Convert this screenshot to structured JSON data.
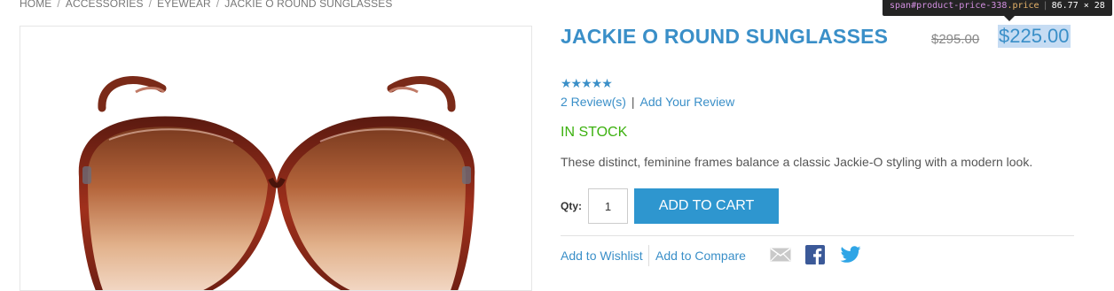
{
  "breadcrumb": {
    "items": [
      "HOME",
      "ACCESSORIES",
      "EYEWEAR",
      "JACKIE O ROUND SUNGLASSES"
    ],
    "separator": "/"
  },
  "product": {
    "title": "JACKIE O ROUND SUNGLASSES",
    "old_price": "$295.00",
    "price": "$225.00",
    "rating_stars": "★★★★★",
    "rating_value": 5,
    "reviews_link": "2 Review(s)",
    "review_separator": "|",
    "add_review_link": "Add Your Review",
    "stock": "IN STOCK",
    "description": "These distinct, feminine frames balance a classic Jackie-O styling with a modern look."
  },
  "devtools_tooltip": {
    "selector": "span#product-price-338",
    "class": ".price",
    "divider": "|",
    "size": "86.77 × 28"
  },
  "cart": {
    "qty_label": "Qty:",
    "qty_value": "1",
    "add_to_cart": "ADD TO CART"
  },
  "actions": {
    "wishlist": "Add to Wishlist",
    "compare": "Add to Compare"
  },
  "icons": {
    "email": "envelope-icon",
    "facebook": "facebook-icon",
    "twitter": "twitter-icon"
  },
  "colors": {
    "accent": "#3a8fc8",
    "button": "#2e96cf",
    "stock": "#3cb10f",
    "highlight": "#c6dcf3"
  }
}
